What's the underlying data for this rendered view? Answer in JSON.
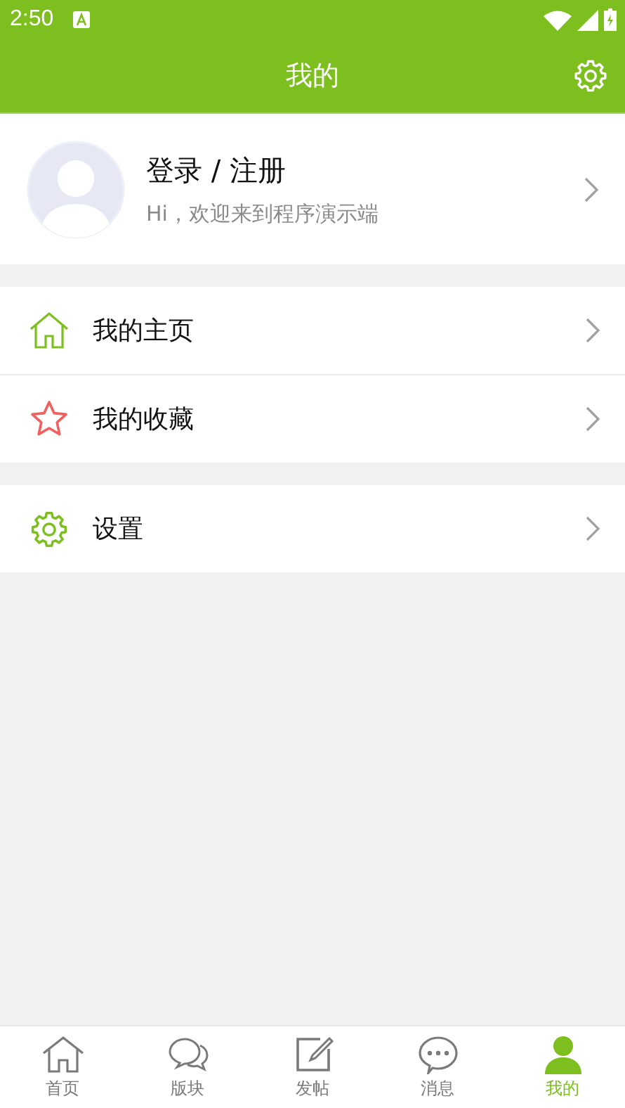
{
  "status_bar": {
    "time": "2:50"
  },
  "header": {
    "title": "我的"
  },
  "profile": {
    "name": "登录 / 注册",
    "greeting": "Hi，欢迎来到程序演示端"
  },
  "menu_groups": [
    {
      "items": [
        {
          "kind": "home",
          "label": "我的主页"
        },
        {
          "kind": "star",
          "label": "我的收藏"
        }
      ]
    },
    {
      "items": [
        {
          "kind": "gear",
          "label": "设置"
        }
      ]
    }
  ],
  "tabs": [
    {
      "kind": "home",
      "label": "首页",
      "selected": false
    },
    {
      "kind": "chat",
      "label": "版块",
      "selected": false
    },
    {
      "kind": "edit",
      "label": "发帖",
      "selected": false
    },
    {
      "kind": "message",
      "label": "消息",
      "selected": false
    },
    {
      "kind": "person",
      "label": "我的",
      "selected": true
    }
  ]
}
